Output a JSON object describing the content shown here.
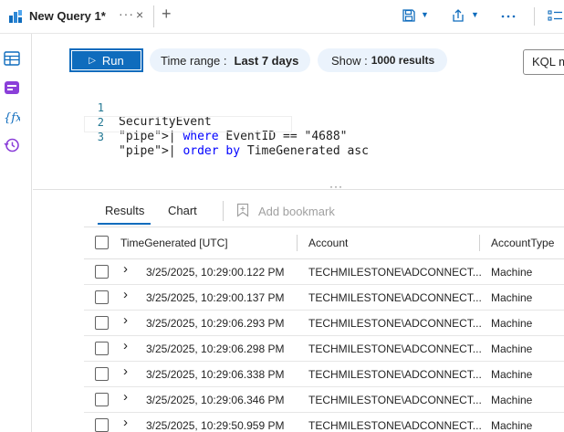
{
  "tab": {
    "title": "New Query 1*",
    "more": "···",
    "close": "×",
    "add": "+"
  },
  "toolbar_icons": [
    "save-icon",
    "share-icon",
    "more-icon",
    "list-icon"
  ],
  "query_toolbar": {
    "run_label": "Run",
    "time_range_label": "Time range :",
    "time_range_value": "Last 7 days",
    "show_label": "Show :",
    "show_value": "1000 results",
    "mode_label": "KQL mode"
  },
  "editor": {
    "lines": [
      {
        "num": "1",
        "text": "SecurityEvent"
      },
      {
        "num": "2",
        "text": "| where EventID == \"4688\""
      },
      {
        "num": "3",
        "text": "| order by TimeGenerated asc"
      }
    ]
  },
  "results_tabs": {
    "results": "Results",
    "chart": "Chart",
    "bookmark": "Add bookmark"
  },
  "grid": {
    "columns": [
      "TimeGenerated [UTC]",
      "Account",
      "AccountType"
    ],
    "rows": [
      [
        "3/25/2025, 10:29:00.122 PM",
        "TECHMILESTONE\\ADCONNECT...",
        "Machine"
      ],
      [
        "3/25/2025, 10:29:00.137 PM",
        "TECHMILESTONE\\ADCONNECT...",
        "Machine"
      ],
      [
        "3/25/2025, 10:29:06.293 PM",
        "TECHMILESTONE\\ADCONNECT...",
        "Machine"
      ],
      [
        "3/25/2025, 10:29:06.298 PM",
        "TECHMILESTONE\\ADCONNECT...",
        "Machine"
      ],
      [
        "3/25/2025, 10:29:06.338 PM",
        "TECHMILESTONE\\ADCONNECT...",
        "Machine"
      ],
      [
        "3/25/2025, 10:29:06.346 PM",
        "TECHMILESTONE\\ADCONNECT...",
        "Machine"
      ],
      [
        "3/25/2025, 10:29:50.959 PM",
        "TECHMILESTONE\\ADCONNECT...",
        "Machine"
      ]
    ]
  },
  "colors": {
    "accent": "#0f6cbd",
    "pill_bg": "#ebf3fc",
    "keyword": "#0000ff",
    "string": "#a31515"
  }
}
